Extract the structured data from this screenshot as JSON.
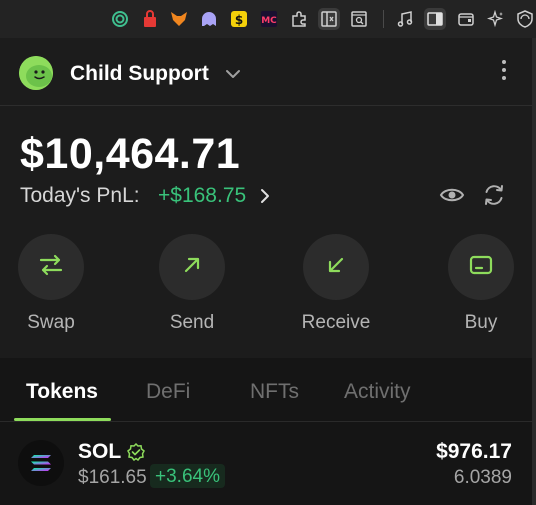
{
  "browser_toolbar": {
    "extension_icons": [
      "spiral-icon",
      "lock-icon",
      "fox-icon",
      "ghost-icon",
      "dollar-icon",
      "mc-icon",
      "puzzle-icon",
      "split-view-icon",
      "search-tab-icon",
      "music-icon",
      "sidebar-icon",
      "wallet-icon",
      "sparkle-icon",
      "shield-icon"
    ]
  },
  "header": {
    "account_name": "Child Support",
    "avatar_color": "#8edc5c"
  },
  "portfolio": {
    "balance": "$10,464.71",
    "pnl_label": "Today's PnL:",
    "pnl_value": "+$168.75",
    "pnl_color": "#39c27a"
  },
  "actions": [
    {
      "label": "Swap",
      "icon": "swap-icon"
    },
    {
      "label": "Send",
      "icon": "send-arrow-icon"
    },
    {
      "label": "Receive",
      "icon": "receive-arrow-icon"
    },
    {
      "label": "Buy",
      "icon": "card-icon"
    }
  ],
  "accent_color": "#8edc5c",
  "tabs": [
    {
      "label": "Tokens",
      "active": true
    },
    {
      "label": "DeFi",
      "active": false
    },
    {
      "label": "NFTs",
      "active": false
    },
    {
      "label": "Activity",
      "active": false
    }
  ],
  "tokens": [
    {
      "symbol": "SOL",
      "price": "$161.65",
      "change": "+3.64%",
      "value": "$976.17",
      "amount": "6.0389",
      "verified": true
    }
  ]
}
